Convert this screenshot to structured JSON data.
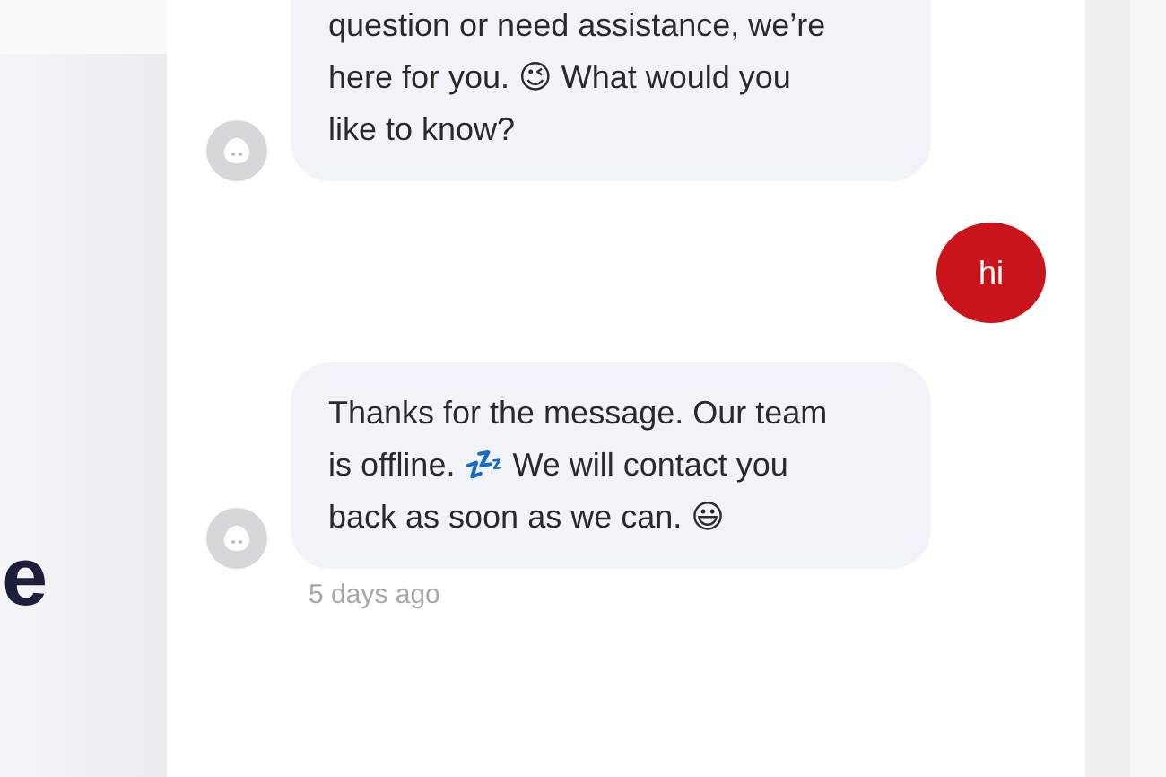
{
  "page": {
    "heading_fragment": "e"
  },
  "messages": [
    {
      "kind": "bot",
      "lines": [
        "question or need assistance, we’re",
        "here for you. 😉  What would you",
        "like to know?"
      ]
    },
    {
      "kind": "user",
      "lines": [
        "hi"
      ]
    },
    {
      "kind": "bot",
      "lines": [
        "Thanks for the message. Our team",
        "is offline. 💤  We will contact you",
        "back as soon as we can. 😃"
      ],
      "time": "5 days ago"
    }
  ]
}
